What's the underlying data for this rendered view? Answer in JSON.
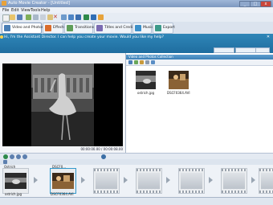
{
  "window": {
    "title": "Auto Movie Creator - [Untitled]"
  },
  "menu": [
    "File",
    "Edit",
    "View",
    "Tools",
    "Help"
  ],
  "tabs": [
    {
      "label": "Video and Photos",
      "icon": "film-icon",
      "selected": true
    },
    {
      "label": "Effects",
      "icon": "effects-icon"
    },
    {
      "label": "Transitions",
      "icon": "transitions-icon"
    },
    {
      "label": "Titles and Credits",
      "icon": "titles-icon"
    },
    {
      "label": "Music",
      "icon": "music-icon"
    },
    {
      "label": "Export",
      "icon": "export-icon"
    }
  ],
  "assistant": {
    "message": "Hi, I'm the Assistant Director. I can help you create your movie. Would you like my help?"
  },
  "preview": {
    "time": "00:00:00.00 / 00:00:08.00"
  },
  "collection": {
    "title": "Video and Photos Collection",
    "items": [
      {
        "name": "ostrich.jpg"
      },
      {
        "name": "DSCF0364.AVI"
      }
    ]
  },
  "timeline": {
    "clips": [
      {
        "name": "ostrich.jpg",
        "label": "Ostrich"
      },
      {
        "name": "DSCF0364.AVI",
        "label": "DSCF0..."
      }
    ]
  },
  "colors": {
    "accent": "#2f86b8",
    "selection": "#3399cc"
  }
}
